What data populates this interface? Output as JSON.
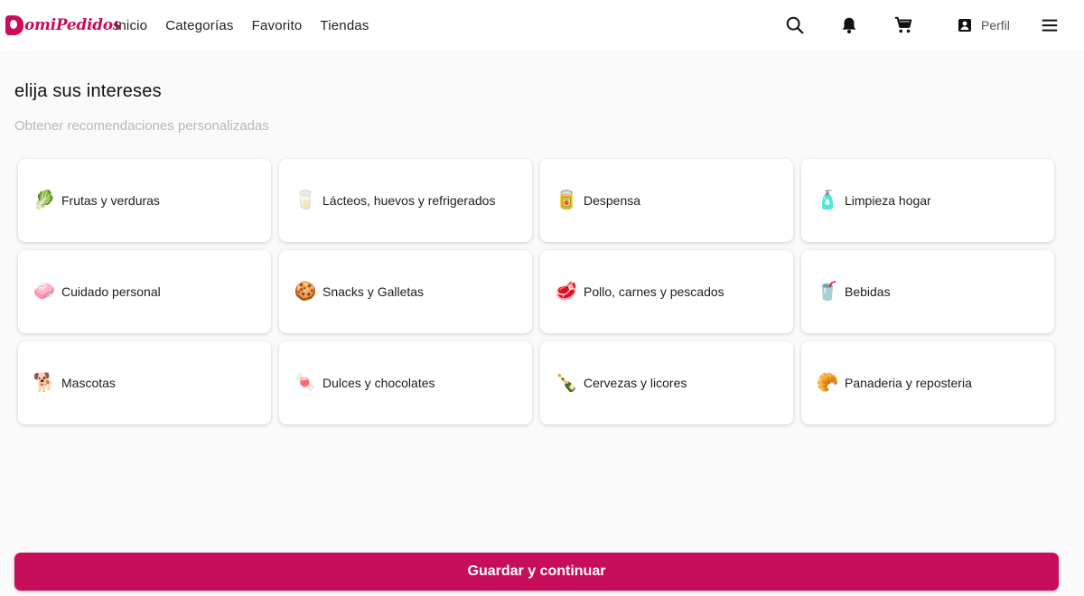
{
  "header": {
    "logo_text": "omiPedidos",
    "nav": [
      {
        "label": "Inicio"
      },
      {
        "label": "Categorías"
      },
      {
        "label": "Favorito"
      },
      {
        "label": "Tiendas"
      }
    ],
    "profile_label": "Perfil",
    "icons": [
      "search-icon",
      "bell-icon",
      "cart-icon",
      "profile-icon",
      "menu-icon"
    ]
  },
  "main": {
    "title": "elija sus intereses",
    "subtitle": "Obtener recomendaciones personalizadas",
    "categories": [
      {
        "label": "Frutas y verduras",
        "icon": "🥬"
      },
      {
        "label": "Lácteos, huevos y refrigerados",
        "icon": "🥛"
      },
      {
        "label": "Despensa",
        "icon": "🥫"
      },
      {
        "label": "Limpieza hogar",
        "icon": "🧴"
      },
      {
        "label": "Cuidado personal",
        "icon": "🧼"
      },
      {
        "label": "Snacks y Galletas",
        "icon": "🍪"
      },
      {
        "label": "Pollo, carnes y pescados",
        "icon": "🥩"
      },
      {
        "label": "Bebidas",
        "icon": "🥤"
      },
      {
        "label": "Mascotas",
        "icon": "🐕"
      },
      {
        "label": "Dulces y chocolates",
        "icon": "🍬"
      },
      {
        "label": "Cervezas y licores",
        "icon": "🍾"
      },
      {
        "label": "Panaderia y reposteria",
        "icon": "🥐"
      }
    ],
    "save_label": "Guardar y continuar"
  },
  "colors": {
    "brand": "#c80d5a",
    "background": "#fafafa",
    "card": "#ffffff",
    "subtitle": "#b8b8b8"
  }
}
